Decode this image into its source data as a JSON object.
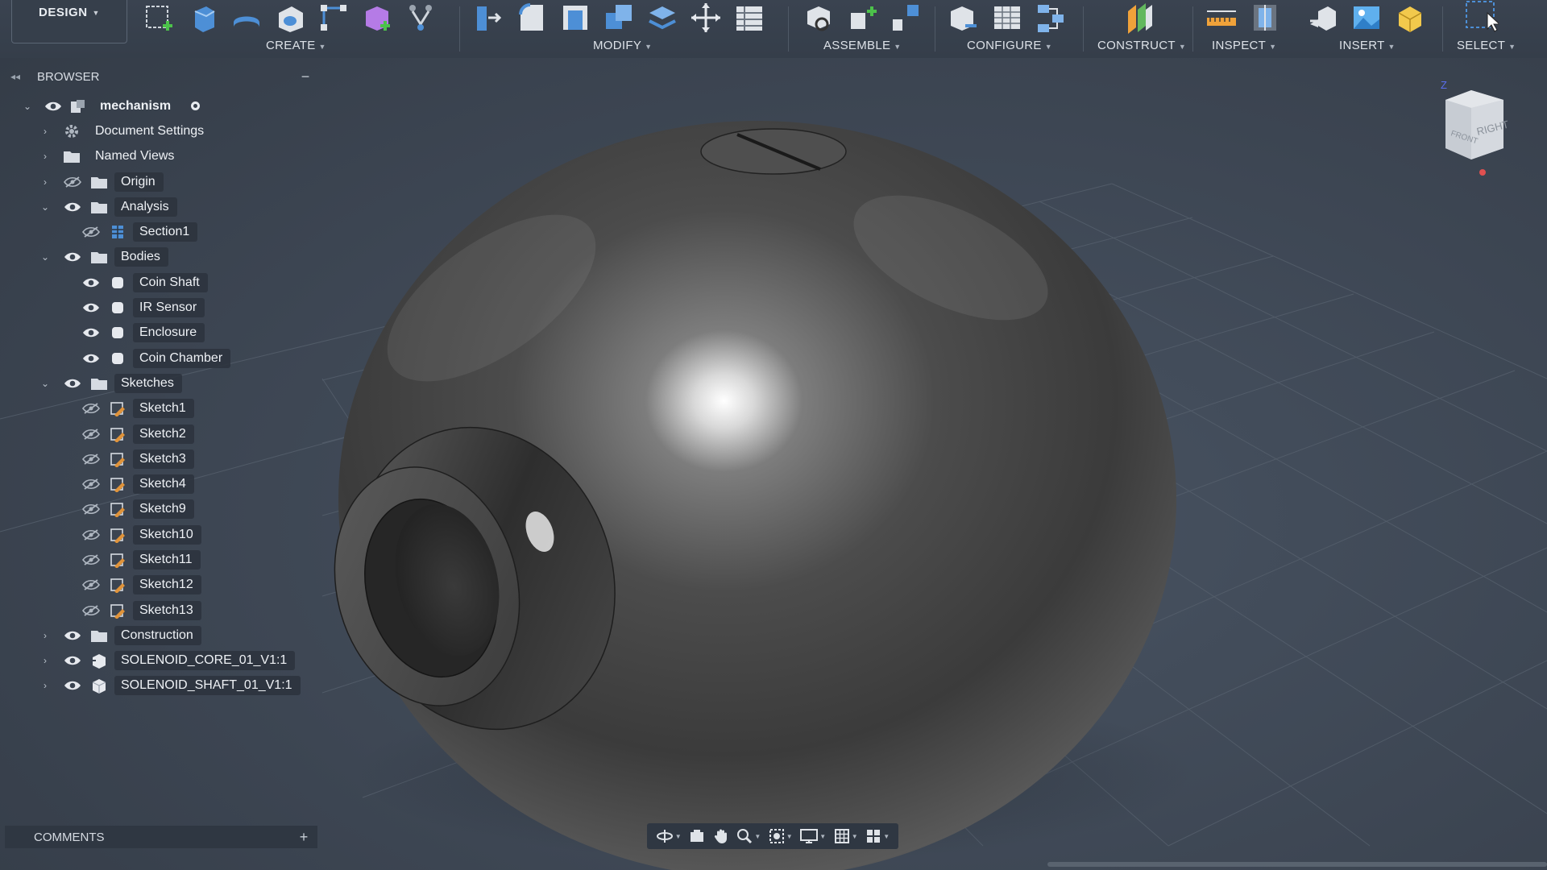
{
  "toolbar": {
    "workspace": "DESIGN",
    "groups": {
      "create": "CREATE",
      "modify": "MODIFY",
      "assemble": "ASSEMBLE",
      "configure": "CONFIGURE",
      "construct": "CONSTRUCT",
      "inspect": "INSPECT",
      "insert": "INSERT",
      "select": "SELECT"
    }
  },
  "browser": {
    "title": "BROWSER",
    "root": "mechanism",
    "items": [
      {
        "label": "Document Settings",
        "icon": "gear-icon"
      },
      {
        "label": "Named Views",
        "icon": "folder-icon"
      },
      {
        "label": "Origin",
        "icon": "folder-icon",
        "hidden": true
      },
      {
        "label": "Analysis",
        "icon": "folder-icon"
      },
      {
        "label": "Section1",
        "icon": "section-analysis-icon",
        "hidden": true
      },
      {
        "label": "Bodies",
        "icon": "folder-icon"
      },
      {
        "label": "Coin Shaft",
        "icon": "body-icon"
      },
      {
        "label": "IR Sensor",
        "icon": "body-icon"
      },
      {
        "label": "Enclosure",
        "icon": "body-icon"
      },
      {
        "label": "Coin Chamber",
        "icon": "body-icon"
      },
      {
        "label": "Sketches",
        "icon": "folder-icon"
      },
      {
        "label": "Sketch1",
        "icon": "sketch-icon",
        "hidden": true
      },
      {
        "label": "Sketch2",
        "icon": "sketch-icon",
        "hidden": true
      },
      {
        "label": "Sketch3",
        "icon": "sketch-icon",
        "hidden": true
      },
      {
        "label": "Sketch4",
        "icon": "sketch-icon",
        "hidden": true
      },
      {
        "label": "Sketch9",
        "icon": "sketch-icon",
        "hidden": true
      },
      {
        "label": "Sketch10",
        "icon": "sketch-icon",
        "hidden": true
      },
      {
        "label": "Sketch11",
        "icon": "sketch-icon",
        "hidden": true
      },
      {
        "label": "Sketch12",
        "icon": "sketch-icon",
        "hidden": true
      },
      {
        "label": "Sketch13",
        "icon": "sketch-icon",
        "hidden": true
      },
      {
        "label": "Construction",
        "icon": "folder-icon"
      },
      {
        "label": "SOLENOID_CORE_01_V1:1",
        "icon": "component-link-icon"
      },
      {
        "label": "SOLENOID_SHAFT_01_V1:1",
        "icon": "component-icon"
      }
    ]
  },
  "comments": {
    "title": "COMMENTS"
  },
  "viewcube": {
    "front": "FRONT",
    "right": "RIGHT",
    "axis_z": "Z"
  },
  "colors": {
    "background": "#3b4451",
    "panel_label_bg": "#2c333d",
    "body_dark": "#2a2a2a",
    "body_highlight": "#ffffff"
  }
}
